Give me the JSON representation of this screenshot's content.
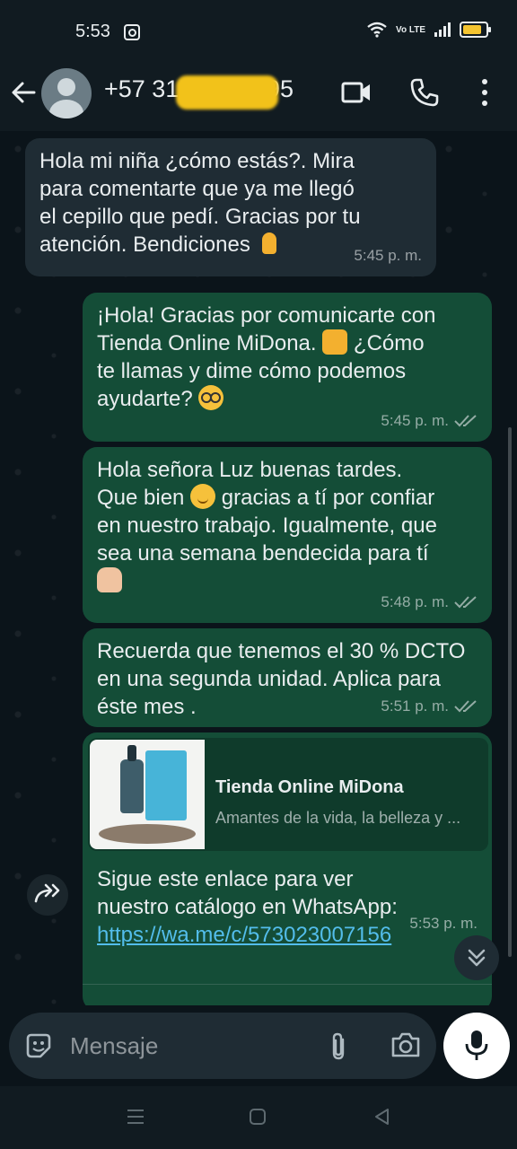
{
  "status_bar": {
    "time": "5:53",
    "network": "Vo LTE"
  },
  "header": {
    "contact": "+57 315 4540795"
  },
  "messages": [
    {
      "type": "in",
      "text_lines": [
        "Hola mi niña ¿cómo estás?. Mira",
        "para comentarte que ya me llegó",
        "el cepillo que pedí. Gracias por tu",
        "atención. Bendiciones"
      ],
      "emoji": "folded-hands",
      "time": "5:45 p. m."
    },
    {
      "type": "out",
      "text_lines": [
        "¡Hola! Gracias por comunicarte con",
        "Tienda Online MiDona.",
        "¿Cómo",
        "te llamas y dime cómo podemos",
        "ayudarte?"
      ],
      "time": "5:45 p. m."
    },
    {
      "type": "out",
      "text_lines": [
        "Hola señora Luz buenas tardes.",
        "Que bien",
        "gracias a tí por confiar",
        "en nuestro trabajo.  Igualmente, que",
        "sea una semana bendecida para tí"
      ],
      "time": "5:48 p. m."
    },
    {
      "type": "out",
      "text_lines": [
        "Recuerda que tenemos el 30 % DCTO",
        "en una segunda unidad. Aplica para",
        "éste mes ."
      ],
      "time": "5:51 p. m."
    },
    {
      "type": "out",
      "link_title": "Tienda Online MiDona",
      "link_desc": "Amantes de la vida, la belleza y ...",
      "text_lines": [
        "Sigue este enlace para ver",
        "nuestro catálogo en WhatsApp:"
      ],
      "url": "https://wa.me/c/573023007156",
      "time": "5:53 p. m."
    }
  ],
  "input": {
    "placeholder": "Mensaje"
  },
  "colors": {
    "incoming": "#1f2c34",
    "outgoing": "#144d37",
    "background": "#0b141a",
    "link": "#53bdeb"
  },
  "icons": [
    "back-arrow-icon",
    "video-call-icon",
    "voice-call-icon",
    "more-menu-icon",
    "sticker-icon",
    "attach-icon",
    "camera-icon",
    "mic-icon",
    "forward-icon",
    "scroll-down-icon"
  ]
}
